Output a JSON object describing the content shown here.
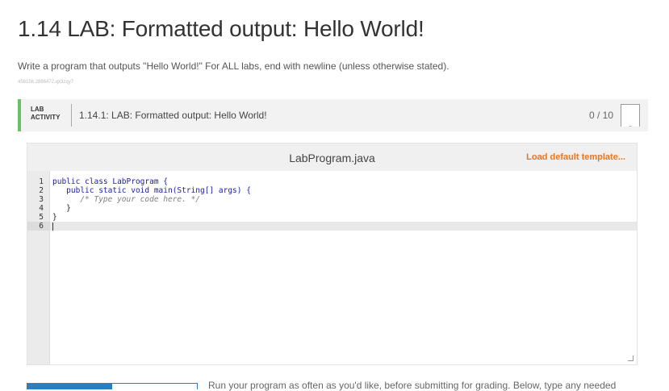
{
  "page": {
    "title": "1.14 LAB: Formatted output: Hello World!",
    "instructions": "Write a program that outputs \"Hello World!\" For ALL labs, end with newline (unless otherwise stated).",
    "ref_id": "456158.2886472.qx3zqy7"
  },
  "lab": {
    "tag_line1": "LAB",
    "tag_line2": "ACTIVITY",
    "name": "1.14.1: LAB: Formatted output: Hello World!",
    "score": "0 / 10"
  },
  "editor": {
    "file_name": "LabProgram.java",
    "load_template_label": "Load default template...",
    "line_numbers": [
      "1",
      "2",
      "3",
      "4",
      "5",
      "6"
    ],
    "code_lines": [
      "public class LabProgram {",
      "   public static void main(String[] args) {",
      "      /* Type your code here. */",
      "   }",
      "}",
      ""
    ]
  },
  "footer": {
    "run_text": "Run your program as often as you'd like, before submitting for grading. Below, type any needed"
  },
  "colors": {
    "accent_green": "#6abf69",
    "load_template_orange": "#e87722",
    "tab_blue": "#2a7fc0"
  }
}
